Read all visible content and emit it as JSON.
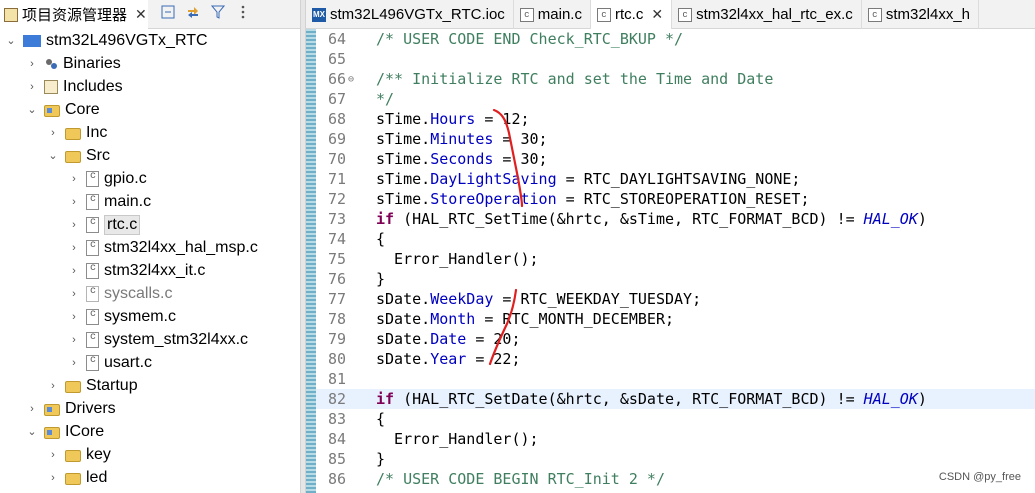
{
  "explorer": {
    "tab_title": "项目资源管理器",
    "tab_close": "✕",
    "tree": [
      {
        "level": 0,
        "state": "open",
        "icon": "ide",
        "label": "stm32L496VGTx_RTC"
      },
      {
        "level": 1,
        "state": "closed",
        "icon": "binaries",
        "label": "Binaries"
      },
      {
        "level": 1,
        "state": "closed",
        "icon": "includes",
        "label": "Includes"
      },
      {
        "level": 1,
        "state": "open",
        "icon": "srcfolder",
        "label": "Core"
      },
      {
        "level": 2,
        "state": "closed",
        "icon": "folder",
        "label": "Inc"
      },
      {
        "level": 2,
        "state": "open",
        "icon": "folder",
        "label": "Src"
      },
      {
        "level": 3,
        "state": "closed",
        "icon": "file",
        "label": "gpio.c"
      },
      {
        "level": 3,
        "state": "closed",
        "icon": "file",
        "label": "main.c"
      },
      {
        "level": 3,
        "state": "closed",
        "icon": "file",
        "label": "rtc.c",
        "selected": true
      },
      {
        "level": 3,
        "state": "closed",
        "icon": "file",
        "label": "stm32l4xx_hal_msp.c"
      },
      {
        "level": 3,
        "state": "closed",
        "icon": "file",
        "label": "stm32l4xx_it.c"
      },
      {
        "level": 3,
        "state": "closed",
        "icon": "file-dim",
        "label": "syscalls.c",
        "dim": true
      },
      {
        "level": 3,
        "state": "closed",
        "icon": "file",
        "label": "sysmem.c"
      },
      {
        "level": 3,
        "state": "closed",
        "icon": "file",
        "label": "system_stm32l4xx.c"
      },
      {
        "level": 3,
        "state": "closed",
        "icon": "file",
        "label": "usart.c"
      },
      {
        "level": 2,
        "state": "closed",
        "icon": "folder",
        "label": "Startup"
      },
      {
        "level": 1,
        "state": "closed",
        "icon": "srcfolder",
        "label": "Drivers"
      },
      {
        "level": 1,
        "state": "open",
        "icon": "srcfolder",
        "label": "ICore"
      },
      {
        "level": 2,
        "state": "closed",
        "icon": "folder",
        "label": "key"
      },
      {
        "level": 2,
        "state": "closed",
        "icon": "folder",
        "label": "led"
      }
    ]
  },
  "editor": {
    "tabs": [
      {
        "icon": "mx",
        "label": "stm32L496VGTx_RTC.ioc",
        "active": false
      },
      {
        "icon": "c",
        "label": "main.c",
        "active": false
      },
      {
        "icon": "c",
        "label": "rtc.c",
        "active": true,
        "close": "✕"
      },
      {
        "icon": "c",
        "label": "stm32l4xx_hal_rtc_ex.c",
        "active": false
      },
      {
        "icon": "c",
        "label": "stm32l4xx_h",
        "active": false
      }
    ],
    "lines": [
      {
        "n": "64",
        "tokens": [
          [
            "comment",
            "/* USER CODE END Check_RTC_BKUP */"
          ]
        ]
      },
      {
        "n": "65",
        "tokens": []
      },
      {
        "n": "66",
        "fold": true,
        "tokens": [
          [
            "comment",
            "/** Initialize RTC and set the Time and Date"
          ]
        ]
      },
      {
        "n": "67",
        "tokens": [
          [
            "comment",
            "*/"
          ]
        ]
      },
      {
        "n": "68",
        "tokens": [
          [
            "plain",
            "sTime."
          ],
          [
            "field",
            "Hours"
          ],
          [
            "plain",
            " = 12;"
          ]
        ]
      },
      {
        "n": "69",
        "tokens": [
          [
            "plain",
            "sTime."
          ],
          [
            "field",
            "Minutes"
          ],
          [
            "plain",
            " = 30;"
          ]
        ]
      },
      {
        "n": "70",
        "tokens": [
          [
            "plain",
            "sTime."
          ],
          [
            "field",
            "Seconds"
          ],
          [
            "plain",
            " = 30;"
          ]
        ]
      },
      {
        "n": "71",
        "tokens": [
          [
            "plain",
            "sTime."
          ],
          [
            "field",
            "DayLightSaving"
          ],
          [
            "plain",
            " = RTC_DAYLIGHTSAVING_NONE;"
          ]
        ]
      },
      {
        "n": "72",
        "tokens": [
          [
            "plain",
            "sTime."
          ],
          [
            "field",
            "StoreOperation"
          ],
          [
            "plain",
            " = RTC_STOREOPERATION_RESET;"
          ]
        ]
      },
      {
        "n": "73",
        "tokens": [
          [
            "kw",
            "if"
          ],
          [
            "plain",
            " (HAL_RTC_SetTime(&hrtc, &sTime, RTC_FORMAT_BCD) != "
          ],
          [
            "italic",
            "HAL_OK"
          ],
          [
            "plain",
            ")"
          ]
        ]
      },
      {
        "n": "74",
        "tokens": [
          [
            "plain",
            "{"
          ]
        ]
      },
      {
        "n": "75",
        "tokens": [
          [
            "plain",
            "  Error_Handler();"
          ]
        ]
      },
      {
        "n": "76",
        "tokens": [
          [
            "plain",
            "}"
          ]
        ]
      },
      {
        "n": "77",
        "tokens": [
          [
            "plain",
            "sDate."
          ],
          [
            "field",
            "WeekDay"
          ],
          [
            "plain",
            " = RTC_WEEKDAY_TUESDAY;"
          ]
        ]
      },
      {
        "n": "78",
        "tokens": [
          [
            "plain",
            "sDate."
          ],
          [
            "field",
            "Month"
          ],
          [
            "plain",
            " = RTC_MONTH_DECEMBER;"
          ]
        ]
      },
      {
        "n": "79",
        "tokens": [
          [
            "plain",
            "sDate."
          ],
          [
            "field",
            "Date"
          ],
          [
            "plain",
            " = 20;"
          ]
        ]
      },
      {
        "n": "80",
        "tokens": [
          [
            "plain",
            "sDate."
          ],
          [
            "field",
            "Year"
          ],
          [
            "plain",
            " = 22;"
          ]
        ]
      },
      {
        "n": "81",
        "tokens": []
      },
      {
        "n": "82",
        "highlight": true,
        "tokens": [
          [
            "kw",
            "if"
          ],
          [
            "plain",
            " (HAL_RTC_SetDate(&hrtc, &sDate, RTC_FORMAT_BCD) != "
          ],
          [
            "italic",
            "HAL_OK"
          ],
          [
            "plain",
            ")"
          ]
        ]
      },
      {
        "n": "83",
        "tokens": [
          [
            "plain",
            "{"
          ]
        ]
      },
      {
        "n": "84",
        "tokens": [
          [
            "plain",
            "  Error_Handler();"
          ]
        ]
      },
      {
        "n": "85",
        "tokens": [
          [
            "plain",
            "}"
          ]
        ]
      },
      {
        "n": "86",
        "tokens": [
          [
            "comment",
            "/* USER CODE BEGIN RTC_Init 2 */"
          ]
        ]
      }
    ],
    "watermark": "CSDN @py_free",
    "annotation_color": "#e02020"
  }
}
